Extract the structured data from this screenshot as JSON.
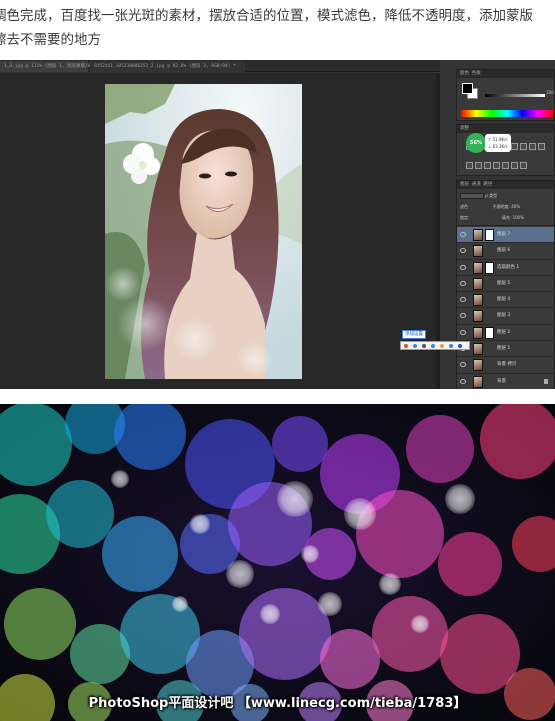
{
  "caption": {
    "line1": "调色完成，百度找一张光斑的素材，摆放合适的位置，模式滤色，降低不透明度，添加蒙版",
    "line2": "擦去不需要的地方"
  },
  "ps": {
    "tabs": [
      "1_3.jpg @ 111% (图层 1, 图层蒙版/8) *",
      "9252441_105238006352_2.jpg @ 82.8% (图层 3, RGB/8#) *"
    ],
    "panels": {
      "color_title": "颜色   色板",
      "color_value": "100",
      "adjust_title": "调整",
      "net_badge": "56%",
      "net_up": "↑ 51.9K/s",
      "net_down": "↓ 63.3K/s",
      "layers_title": "图层   通道   路径",
      "filter_label": "ρ 类型",
      "blend_mode": "滤色",
      "opacity_label": "不透明度:",
      "opacity_value": "40%",
      "lock_label": "锁定:",
      "fill_label": "填充:",
      "fill_value": "100%"
    },
    "layers": [
      {
        "name": "图层 7",
        "selected": true,
        "mask": true
      },
      {
        "name": "图层 6",
        "selected": false,
        "mask": false
      },
      {
        "name": "选取颜色 1",
        "selected": false,
        "mask": true
      },
      {
        "name": "图层 5",
        "selected": false,
        "mask": false
      },
      {
        "name": "图层 4",
        "selected": false,
        "mask": false
      },
      {
        "name": "图层 3",
        "selected": false,
        "mask": false
      },
      {
        "name": "图层 2",
        "selected": false,
        "mask": true
      },
      {
        "name": "图层 1",
        "selected": false,
        "mask": false
      },
      {
        "name": "背景 拷贝",
        "selected": false,
        "mask": false
      },
      {
        "name": "背景",
        "selected": false,
        "mask": false
      }
    ],
    "tooltip": "添加设置"
  },
  "bokeh": {
    "watermark": "PhotoShop平面设计吧 【www.linecg.com/tieba/1783】"
  }
}
